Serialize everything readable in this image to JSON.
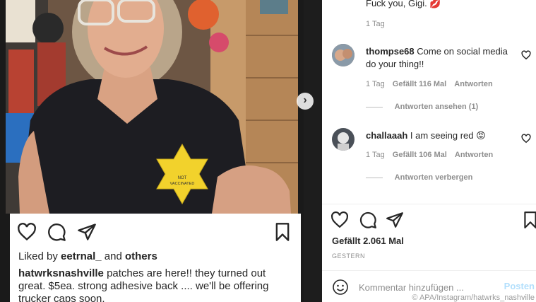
{
  "post": {
    "liked_by_prefix": "Liked by",
    "liked_by_user": "eetrnal_",
    "liked_by_joiner": "and",
    "liked_by_others": "others",
    "caption_user": "hatwrksnashville",
    "caption_text": "patches are here!! they turned out great. $5ea. strong adhesive back .... we'll be offering trucker caps soon.",
    "star_text_line1": "NOT",
    "star_text_line2": "VACCINATED",
    "next_arrow": "›"
  },
  "comments": [
    {
      "text": "Fuck you, Gigi.",
      "emoji": "💋",
      "time": "1 Tag"
    },
    {
      "user": "thompse68",
      "text": "Come on social media do your thing!!",
      "time": "1 Tag",
      "likes": "Gefällt 116 Mal",
      "reply_label": "Antworten",
      "replies_toggle": "Antworten ansehen (1)"
    },
    {
      "user": "challaaah",
      "text": "I am seeing red",
      "emoji": "😡",
      "time": "1 Tag",
      "likes": "Gefällt 106 Mal",
      "reply_label": "Antworten",
      "replies_toggle": "Antworten verbergen"
    }
  ],
  "right_footer": {
    "likes": "Gefällt 2.061 Mal",
    "date": "GESTERN",
    "comment_placeholder": "Kommentar hinzufügen ...",
    "post_label": "Posten",
    "watermark": "© APA/Instagram/hatwrks_nashville"
  },
  "icons": {
    "heart": "heart-icon",
    "comment": "comment-icon",
    "share": "share-icon",
    "bookmark": "bookmark-icon",
    "emoji": "emoji-icon",
    "next": "chevron-right-icon"
  },
  "colors": {
    "star_yellow": "#f2d22c",
    "shirt": "#1d1d22",
    "text": "#262626",
    "muted": "#8e8e8e",
    "post_button": "#b2dffc"
  }
}
